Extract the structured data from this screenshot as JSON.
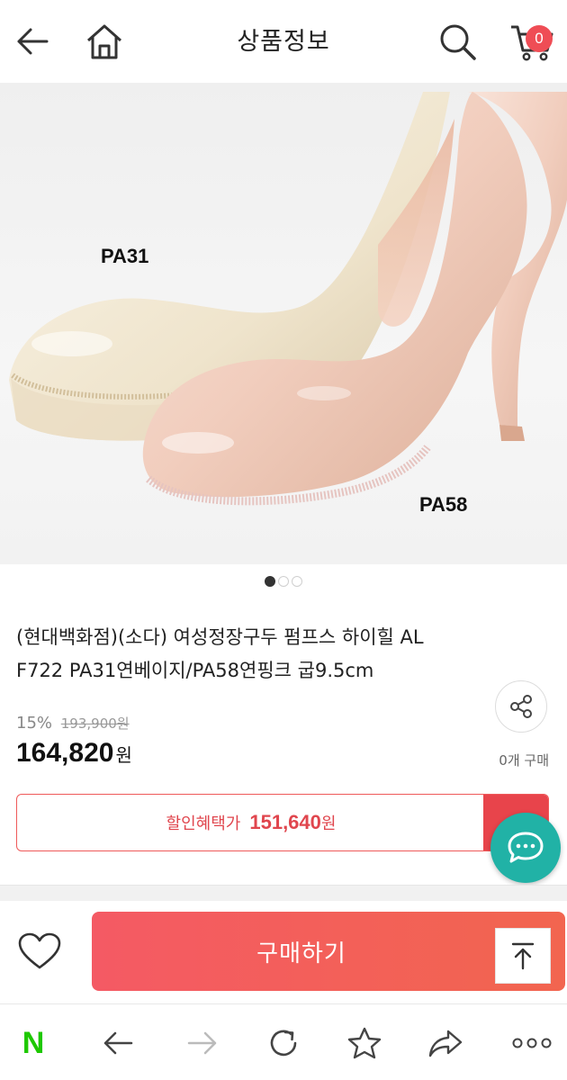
{
  "header": {
    "title": "상품정보",
    "cart_count": "0"
  },
  "product_image": {
    "label_left": "PA31",
    "label_right": "PA58",
    "slide_count": 3,
    "active_slide": 1
  },
  "product": {
    "name_line1": "(현대백화점)(소다) 여성정장구두 펌프스 하이힐 AL",
    "name_line2": "F722 PA31연베이지/PA58연핑크 굽9.5cm",
    "discount_pct": "15%",
    "original_price": "193,900원",
    "price": "164,820",
    "price_unit": "원",
    "purchase_count": "0개 구매"
  },
  "benefit": {
    "label": "할인혜택가",
    "amount": "151,640",
    "unit": "원"
  },
  "buy_bar": {
    "buy_label": "구매하기"
  },
  "browser": {
    "logo": "N"
  },
  "colors": {
    "accent_red": "#ef4d55",
    "buy_gradient_start": "#f45a64",
    "chat_teal": "#21b2a6",
    "naver_green": "#1ec800"
  }
}
